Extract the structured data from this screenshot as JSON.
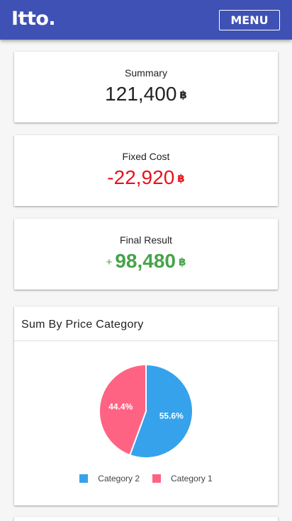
{
  "header": {
    "logo": "Itto.",
    "menu_label": "MENU"
  },
  "cards": {
    "summary": {
      "label": "Summary",
      "value": "121,400",
      "currency": "฿"
    },
    "fixed_cost": {
      "label": "Fixed Cost",
      "value": "-22,920",
      "currency": "฿"
    },
    "final_result": {
      "label": "Final Result",
      "prefix": "+",
      "value": "98,480",
      "currency": "฿"
    }
  },
  "colors": {
    "app_bar": "#3f51b5",
    "negative": "#e8131c",
    "positive": "#46a34a",
    "category_2": "#36a2eb",
    "category_1": "#ff6384"
  },
  "chart_data": {
    "type": "pie",
    "title": "Sum By Price Category",
    "categories": [
      "Category 2",
      "Category 1"
    ],
    "values": [
      55.6,
      44.4
    ],
    "labels": [
      "55.6%",
      "44.4%"
    ],
    "colors": [
      "#36a2eb",
      "#ff6384"
    ],
    "legend_position": "bottom"
  }
}
